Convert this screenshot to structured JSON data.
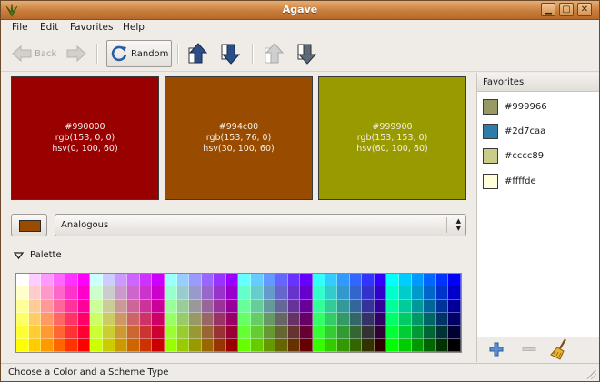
{
  "window": {
    "title": "Agave"
  },
  "menu": [
    {
      "label": "File"
    },
    {
      "label": "Edit"
    },
    {
      "label": "Favorites"
    },
    {
      "label": "Help"
    }
  ],
  "toolbar": {
    "back_label": "Back",
    "random_label": "Random"
  },
  "swatches": [
    {
      "hex": "#990000",
      "rgb": "rgb(153, 0, 0)",
      "hsv": "hsv(0, 100, 60)",
      "color": "#990000"
    },
    {
      "hex": "#994c00",
      "rgb": "rgb(153, 76, 0)",
      "hsv": "hsv(30, 100, 60)",
      "color": "#994c00"
    },
    {
      "hex": "#999900",
      "rgb": "rgb(153, 153, 0)",
      "hsv": "hsv(60, 100, 60)",
      "color": "#999900"
    }
  ],
  "scheme": {
    "selected": "Analogous",
    "current_color": "#994c00"
  },
  "palette": {
    "label": "Palette"
  },
  "favorites": {
    "header": "Favorites",
    "items": [
      {
        "label": "#999966",
        "color": "#999966"
      },
      {
        "label": "#2d7caa",
        "color": "#2d7caa"
      },
      {
        "label": "#cccc89",
        "color": "#cccc89"
      },
      {
        "label": "#ffffde",
        "color": "#ffffde"
      }
    ]
  },
  "status": {
    "text": "Choose a Color and a Scheme Type"
  }
}
